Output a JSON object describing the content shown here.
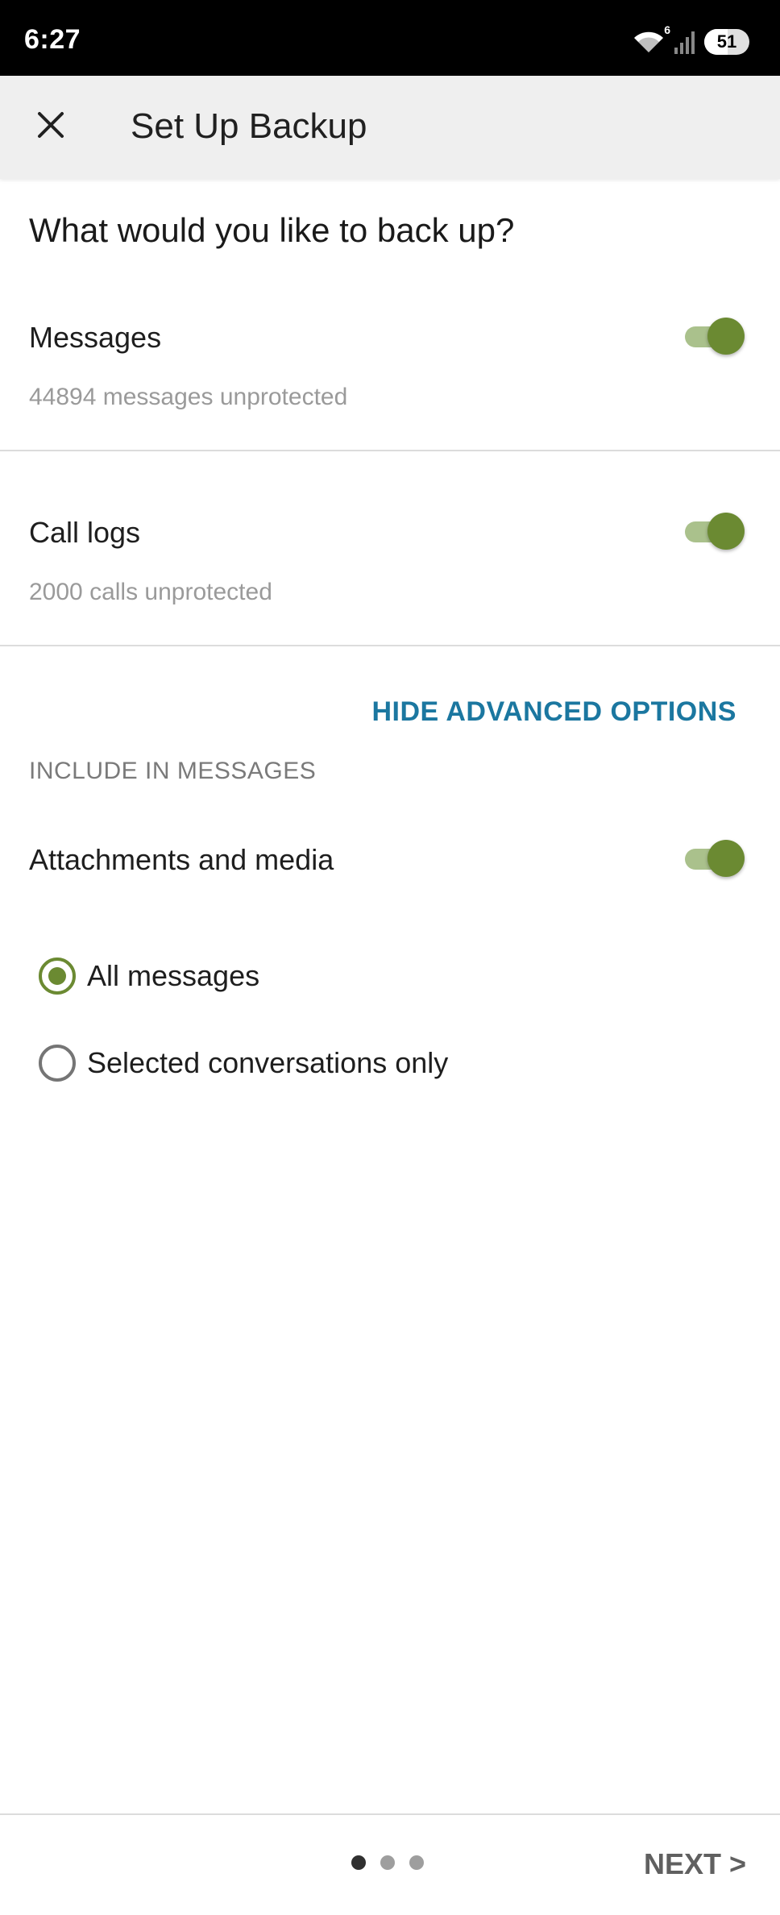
{
  "status_bar": {
    "time": "6:27",
    "wifi_badge": "6",
    "battery_level": "51"
  },
  "app_bar": {
    "title": "Set Up Backup",
    "close_icon": "close-icon"
  },
  "content": {
    "question": "What would you like to back up?",
    "messages": {
      "title": "Messages",
      "subtitle": "44894 messages unprotected",
      "enabled": true
    },
    "call_logs": {
      "title": "Call logs",
      "subtitle": "2000 calls unprotected",
      "enabled": true
    },
    "advanced_toggle_label": "HIDE ADVANCED OPTIONS",
    "include_section_header": "INCLUDE IN MESSAGES",
    "attachments": {
      "title": "Attachments and media",
      "enabled": true
    },
    "scope_options": [
      {
        "label": "All messages",
        "selected": true
      },
      {
        "label": "Selected conversations only",
        "selected": false
      }
    ]
  },
  "footer": {
    "page_count": 3,
    "current_page": 1,
    "next_label": "NEXT >"
  },
  "colors": {
    "accent": "#6b8a32",
    "link": "#1b77a0"
  }
}
